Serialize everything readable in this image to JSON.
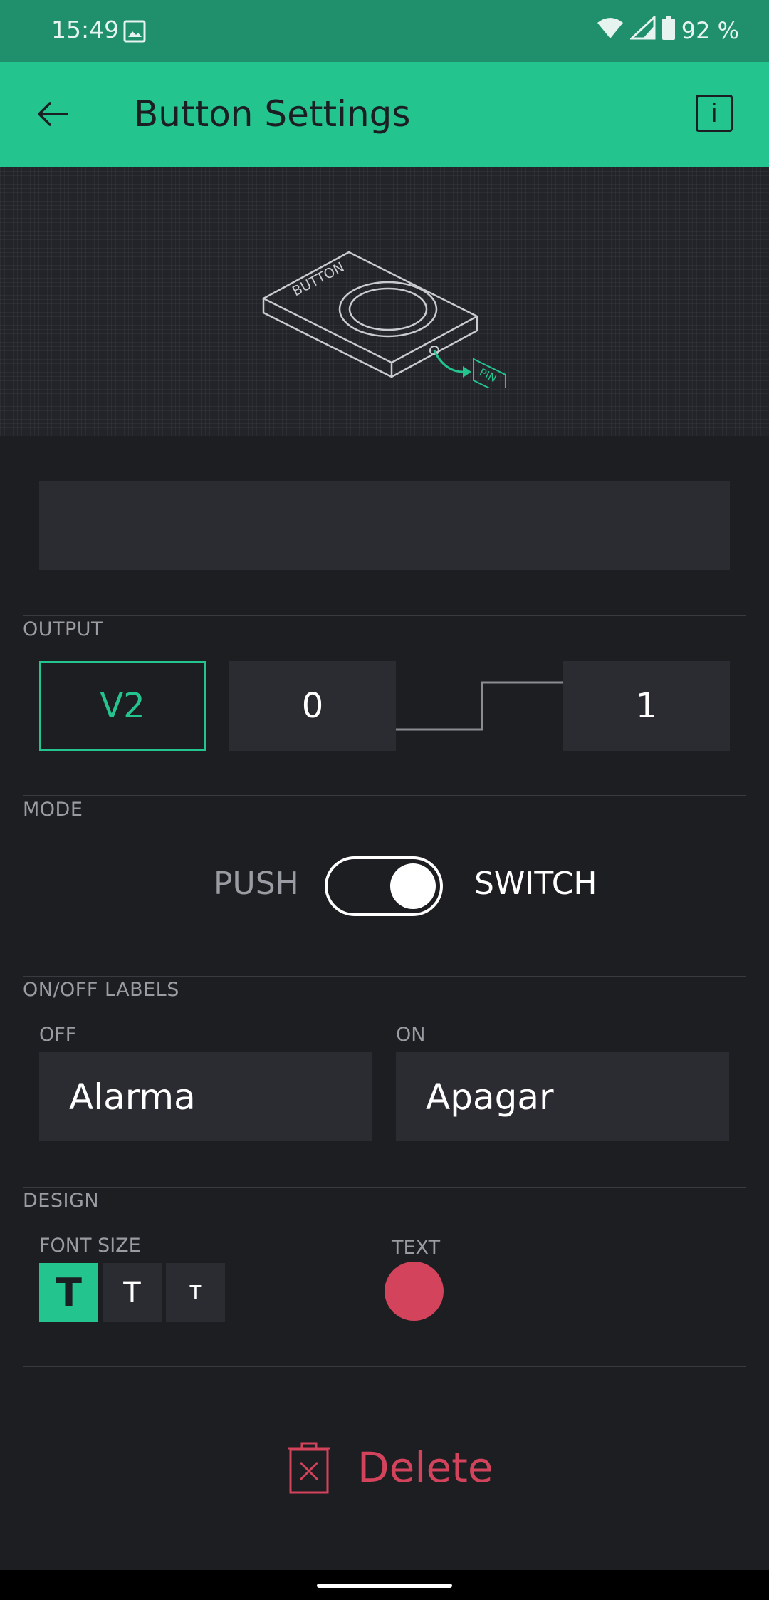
{
  "status_bar": {
    "time": "15:49",
    "battery": "92 %",
    "icons": [
      "image-icon",
      "wifi-icon",
      "signal-icon",
      "battery-icon"
    ]
  },
  "app_bar": {
    "title": "Button Settings",
    "info_label": "i"
  },
  "preview": {
    "device_label": "BUTTON",
    "pin_label": "PIN"
  },
  "name_field": {
    "value": ""
  },
  "output": {
    "section_label": "OUTPUT",
    "pin": "V2",
    "off_value": "0",
    "on_value": "1"
  },
  "mode": {
    "section_label": "MODE",
    "left_label": "PUSH",
    "right_label": "SWITCH",
    "selected": "SWITCH"
  },
  "labels": {
    "section_label": "ON/OFF LABELS",
    "off_label": "OFF",
    "off_value": "Alarma",
    "on_label": "ON",
    "on_value": "Apagar"
  },
  "design": {
    "section_label": "DESIGN",
    "font_size_label": "FONT SIZE",
    "font_sizes": [
      "T",
      "T",
      "T"
    ],
    "text_color_label": "TEXT",
    "text_color": "#d3435c"
  },
  "delete": {
    "label": "Delete"
  },
  "colors": {
    "accent": "#23c48e",
    "status_bar": "#1f8f6c",
    "background": "#1d1e22",
    "field": "#2b2c31",
    "danger": "#d3435c"
  }
}
